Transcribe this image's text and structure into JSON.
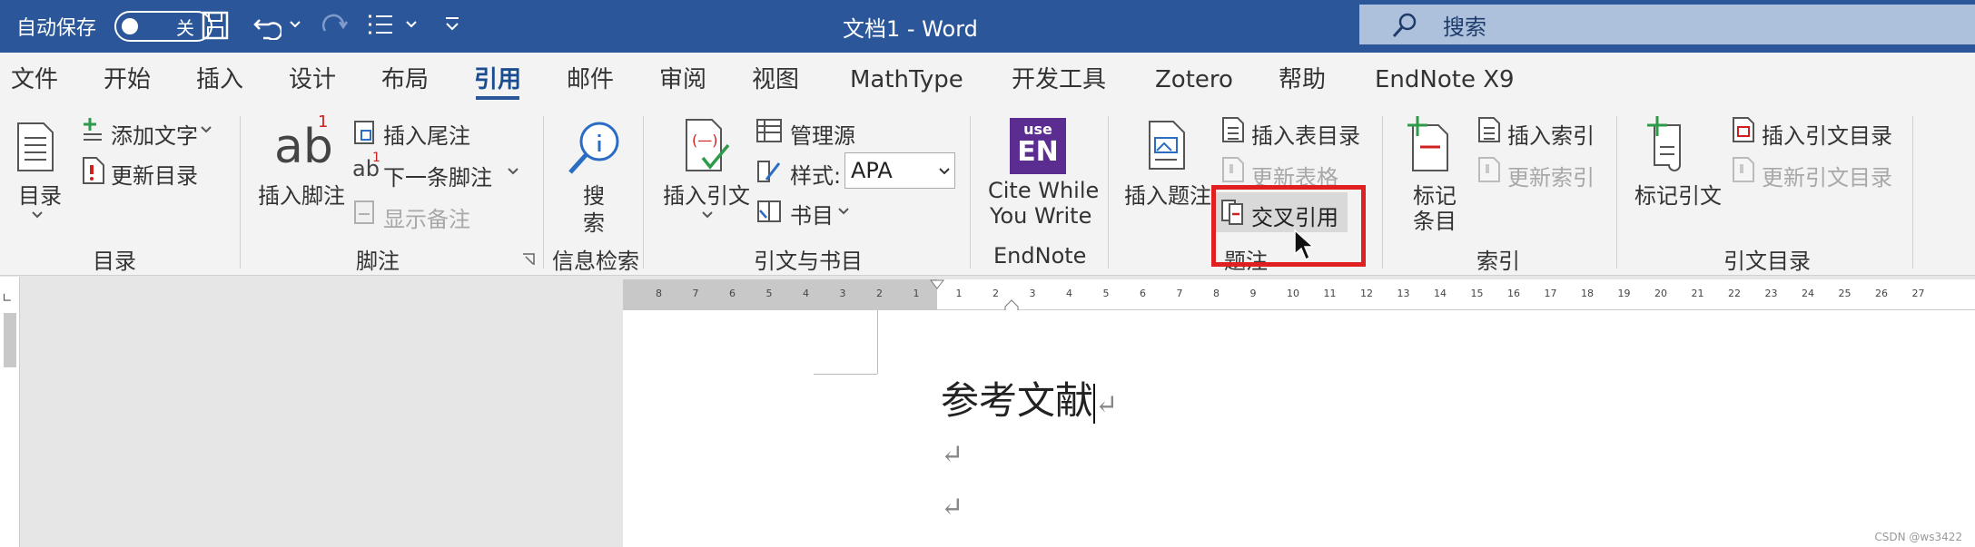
{
  "titlebar": {
    "autosave_label": "自动保存",
    "autosave_state": "关",
    "doc_title": "文档1  -  Word",
    "search_placeholder": "搜索"
  },
  "tabs": [
    "文件",
    "开始",
    "插入",
    "设计",
    "布局",
    "引用",
    "邮件",
    "审阅",
    "视图",
    "MathType",
    "开发工具",
    "Zotero",
    "帮助",
    "EndNote X9"
  ],
  "active_tab": "引用",
  "ribbon": {
    "toc": {
      "toc_label": "目录",
      "add_text": "添加文字",
      "update_toc": "更新目录",
      "group": "目录"
    },
    "footnotes": {
      "insert_footnote": "插入脚注",
      "insert_endnote": "插入尾注",
      "next_footnote": "下一条脚注",
      "show_notes": "显示备注",
      "group": "脚注"
    },
    "research": {
      "search_line1": "搜",
      "search_line2": "索",
      "group": "信息检索"
    },
    "citations": {
      "insert_citation": "插入引文",
      "manage_sources": "管理源",
      "style_label": "样式:",
      "style_value": "APA",
      "bibliography": "书目",
      "group": "引文与书目"
    },
    "endnote": {
      "line1": "Cite While",
      "line2": "You Write",
      "group": "EndNote"
    },
    "captions": {
      "insert_caption": "插入题注",
      "insert_table_of_figures": "插入表目录",
      "update_table": "更新表格",
      "cross_reference": "交叉引用",
      "group": "题注"
    },
    "index": {
      "mark_entry_line1": "标记",
      "mark_entry_line2": "条目",
      "insert_index": "插入索引",
      "update_index": "更新索引",
      "group": "索引"
    },
    "toa": {
      "mark_citation": "标记引文",
      "insert_toa": "插入引文目录",
      "update_toa": "更新引文目录",
      "group": "引文目录"
    }
  },
  "ruler": {
    "left_numbers": [
      "8",
      "7",
      "6",
      "5",
      "4",
      "3",
      "2",
      "1"
    ],
    "right_numbers": [
      "1",
      "2",
      "3",
      "4",
      "5",
      "6",
      "7",
      "8",
      "9",
      "10",
      "11",
      "12",
      "13",
      "14",
      "15",
      "16",
      "17",
      "18",
      "19",
      "20",
      "21",
      "22",
      "23",
      "24",
      "25",
      "26",
      "27"
    ]
  },
  "document": {
    "heading": "参考文献",
    "para_mark": "↵"
  },
  "watermark": "CSDN @ws3422",
  "colors": {
    "titlebar": "#2b579a",
    "highlight_border": "#e02020",
    "endnote_purple": "#5b2d90"
  }
}
